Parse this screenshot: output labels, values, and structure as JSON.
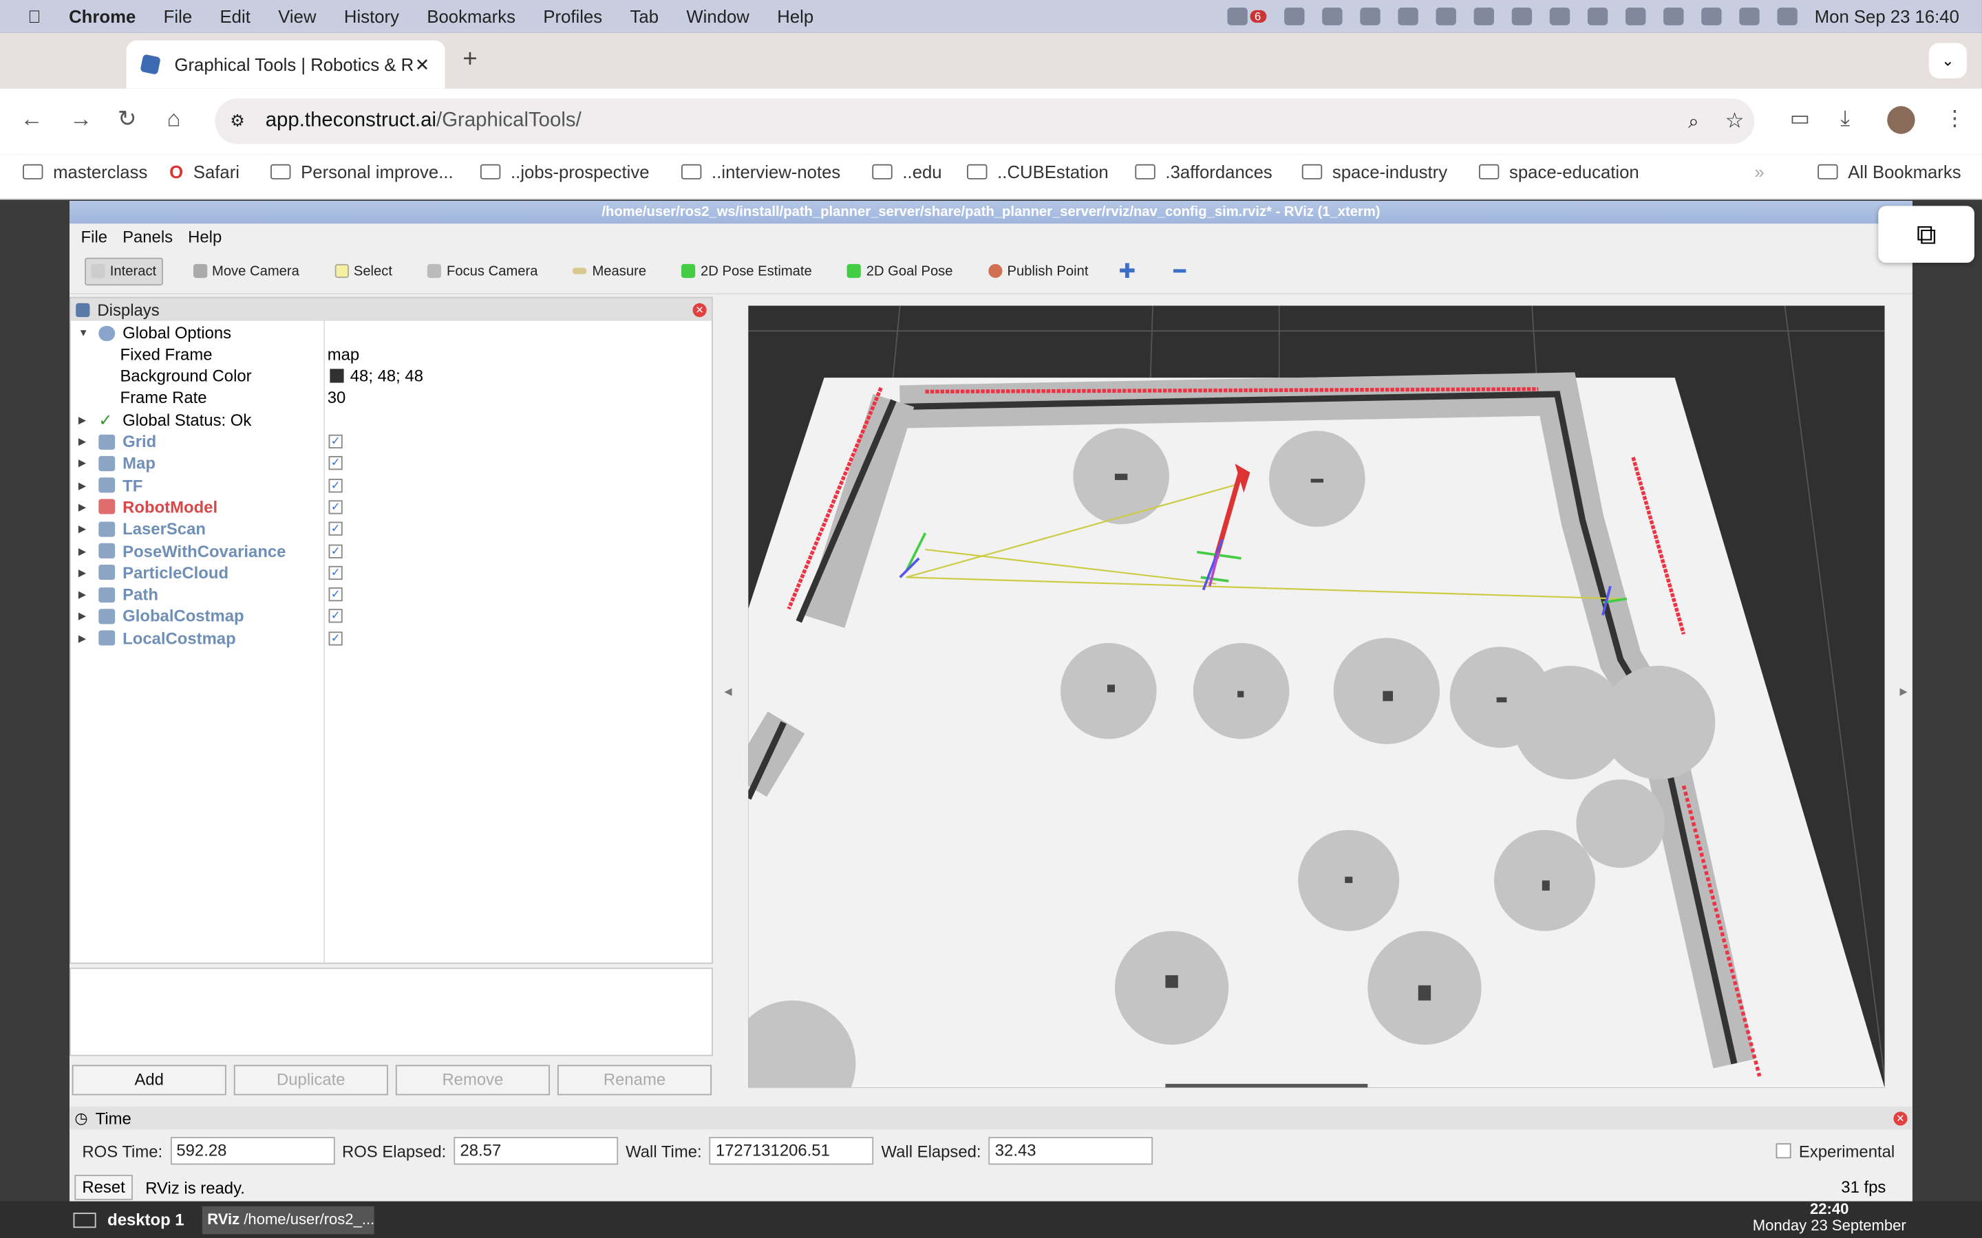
{
  "mac_menu": {
    "app": "Chrome",
    "items": [
      "File",
      "Edit",
      "View",
      "History",
      "Bookmarks",
      "Profiles",
      "Tab",
      "Window",
      "Help"
    ],
    "clock": "Mon Sep 23  16:40",
    "badge": "6"
  },
  "browser": {
    "tab_title": "Graphical Tools | Robotics & R",
    "url_host": "app.theconstruct.ai",
    "url_path": "/GraphicalTools/"
  },
  "bookmarks": [
    "masterclass",
    "Safari",
    "Personal improve...",
    "..jobs-prospective",
    "..interview-notes",
    "..edu",
    "..CUBEstation",
    ".3affordances",
    "space-industry",
    "space-education"
  ],
  "all_bookmarks": "All Bookmarks",
  "rviz": {
    "title": "/home/user/ros2_ws/install/path_planner_server/share/path_planner_server/rviz/nav_config_sim.rviz* - RViz (1_xterm)",
    "menu": [
      "File",
      "Panels",
      "Help"
    ],
    "tools": [
      "Interact",
      "Move Camera",
      "Select",
      "Focus Camera",
      "Measure",
      "2D Pose Estimate",
      "2D Goal Pose",
      "Publish Point"
    ],
    "displays_title": "Displays",
    "global_options": "Global Options",
    "options": [
      {
        "label": "Fixed Frame",
        "value": "map"
      },
      {
        "label": "Background Color",
        "value": "48; 48; 48"
      },
      {
        "label": "Frame Rate",
        "value": "30"
      }
    ],
    "global_status": "Global Status: Ok",
    "displays": [
      {
        "name": "Grid",
        "color": "#6f8fb6"
      },
      {
        "name": "Map",
        "color": "#6f8fb6"
      },
      {
        "name": "TF",
        "color": "#6f8fb6"
      },
      {
        "name": "RobotModel",
        "color": "#d84848"
      },
      {
        "name": "LaserScan",
        "color": "#6f8fb6"
      },
      {
        "name": "PoseWithCovariance",
        "color": "#6f8fb6"
      },
      {
        "name": "ParticleCloud",
        "color": "#6f8fb6"
      },
      {
        "name": "Path",
        "color": "#6f8fb6"
      },
      {
        "name": "GlobalCostmap",
        "color": "#6f8fb6"
      },
      {
        "name": "LocalCostmap",
        "color": "#6f8fb6"
      }
    ],
    "buttons": {
      "add": "Add",
      "duplicate": "Duplicate",
      "remove": "Remove",
      "rename": "Rename"
    },
    "time_title": "Time",
    "ros_time_label": "ROS Time:",
    "ros_time": "592.28",
    "ros_elapsed_label": "ROS Elapsed:",
    "ros_elapsed": "28.57",
    "wall_time_label": "Wall Time:",
    "wall_time": "1727131206.51",
    "wall_elapsed_label": "Wall Elapsed:",
    "wall_elapsed": "32.43",
    "experimental": "Experimental",
    "reset": "Reset",
    "status": "RViz is ready.",
    "fps": "31 fps"
  },
  "taskbar": {
    "desktop": "desktop 1",
    "window": "/home/user/ros2_...",
    "time": "22:40",
    "date": "Monday 23 September"
  }
}
